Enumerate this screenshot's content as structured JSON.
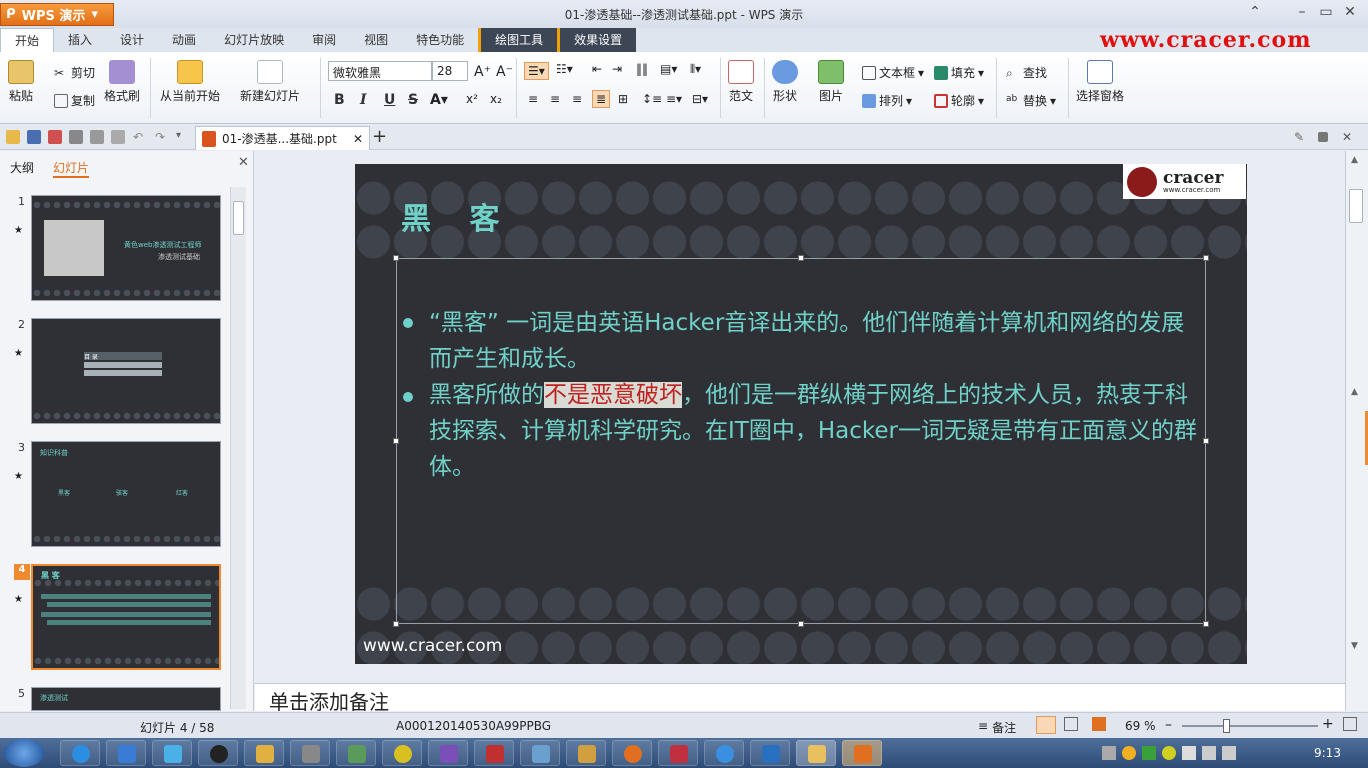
{
  "app": {
    "menu_label": "WPS 演示",
    "window_title": "01-渗透基础--渗透测试基础.ppt - WPS 演示"
  },
  "watermark": "www.cracer.com",
  "tabs": [
    {
      "label": "开始"
    },
    {
      "label": "插入"
    },
    {
      "label": "设计"
    },
    {
      "label": "动画"
    },
    {
      "label": "幻灯片放映"
    },
    {
      "label": "审阅"
    },
    {
      "label": "视图"
    },
    {
      "label": "特色功能"
    },
    {
      "label": "绘图工具"
    },
    {
      "label": "效果设置"
    }
  ],
  "ribbon": {
    "paste": "粘贴",
    "cut": "剪切",
    "copy": "复制",
    "format_painter": "格式刷",
    "from_current": "从当前开始",
    "new_slide": "新建幻灯片",
    "font_name": "微软雅黑",
    "font_size": "28",
    "bold": "B",
    "italic": "I",
    "underline": "U",
    "strike": "S",
    "sample": "范文",
    "shape": "形状",
    "picture": "图片",
    "textbox": "文本框",
    "arrange": "排列",
    "fill": "填充",
    "outline": "轮廓",
    "find": "查找",
    "replace": "替换",
    "select_pane": "选择窗格"
  },
  "doc_tab": {
    "name": "01-渗透基...基础.ppt"
  },
  "left_panel": {
    "tab_outline": "大纲",
    "tab_slides": "幻灯片",
    "thumbs": [
      {
        "num": "1",
        "title": "黄色web渗透测试工程师",
        "subtitle": "渗透测试基础"
      },
      {
        "num": "2",
        "title": "目 录"
      },
      {
        "num": "3",
        "title": "知识科普",
        "items": [
          "黑客",
          "骇客",
          "红客"
        ]
      },
      {
        "num": "4",
        "title": "黑 客"
      },
      {
        "num": "5",
        "title": "渗透测试"
      }
    ]
  },
  "slide": {
    "title": "黑 客",
    "logo_text": "cracer",
    "logo_url": "www.cracer.com",
    "para1": "“黑客” 一词是由英语Hacker音译出来的。他们伴随着计算机和网络的发展而产生和成长。",
    "para2_a": "黑客所做的",
    "para2_hl": "不是恶意破坏",
    "para2_b": "，他们是一群纵横于网络上的技术人员，热衷于科技探索、计算机科学研究。在IT圈中，Hacker一词无疑是带有正面意义的群体。",
    "site_url": "www.cracer.com"
  },
  "notes_placeholder": "单击添加备注",
  "status": {
    "slide_counter": "幻灯片 4 / 58",
    "code": "A000120140530A99PPBG",
    "notes_btn": "备注",
    "zoom": "69 %"
  },
  "clock": "9:13"
}
